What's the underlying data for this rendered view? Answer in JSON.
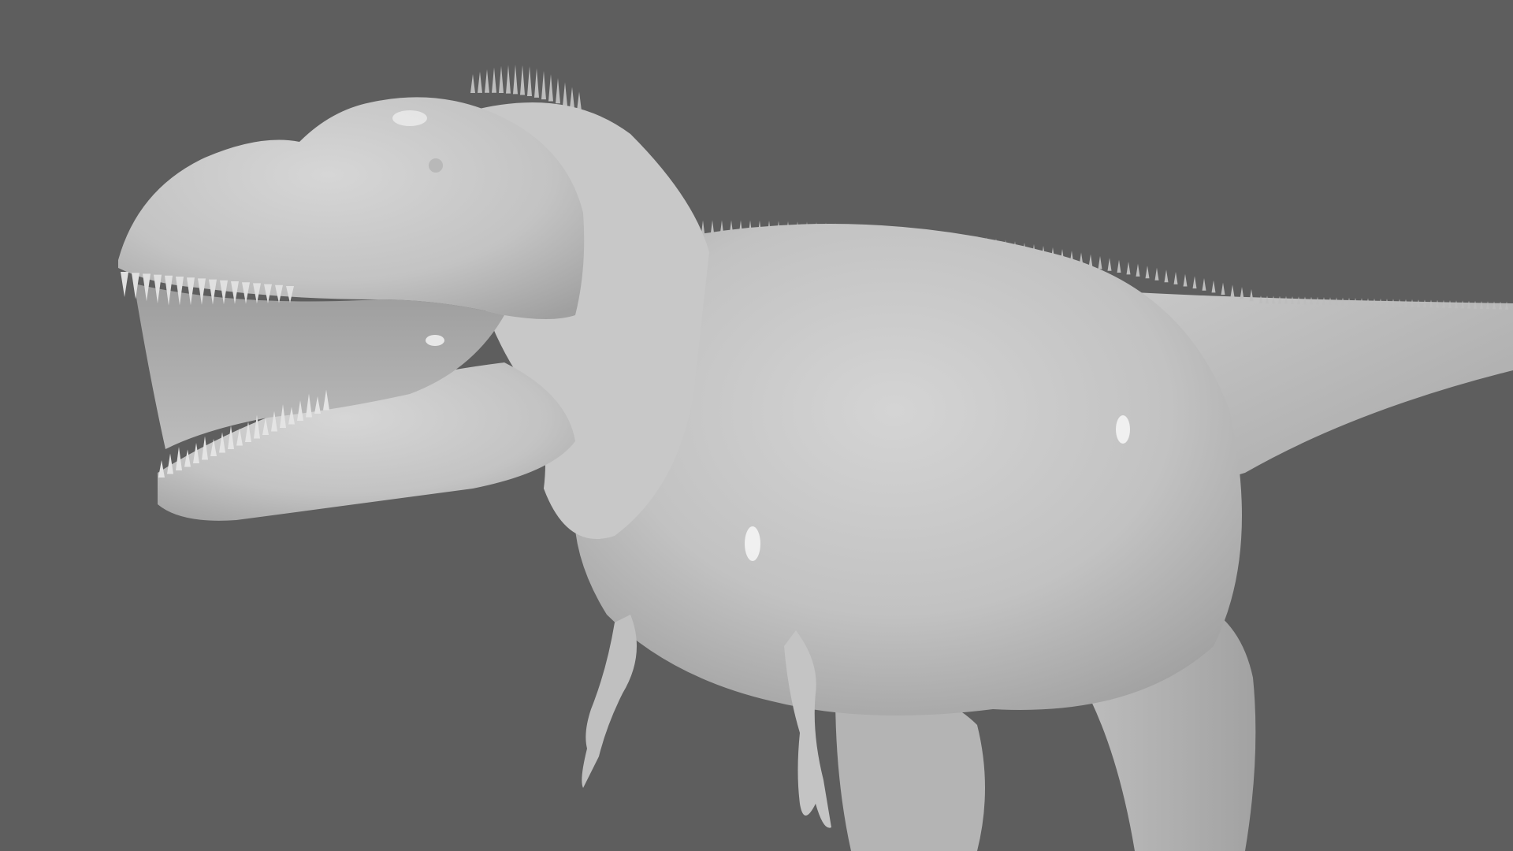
{
  "viewport": {
    "background_color": "#5e5e5e",
    "subject": "t-rex-clay-render",
    "material_color": "#c4c4c4",
    "highlight_color": "#f4f4f4",
    "shadow_color": "#8e8e8e"
  }
}
